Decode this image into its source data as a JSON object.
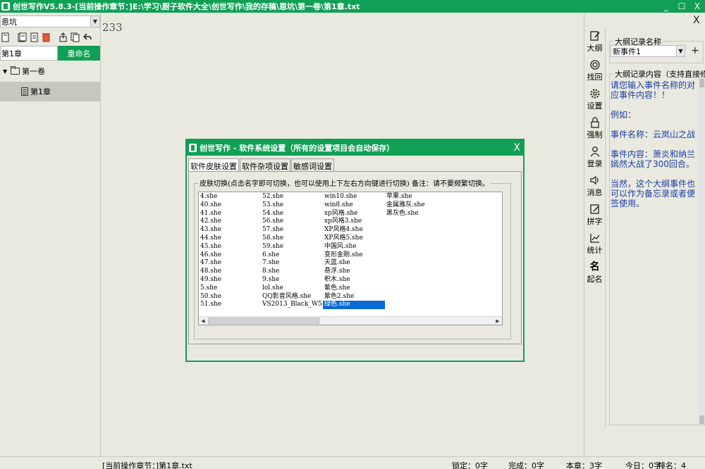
{
  "window": {
    "title": "创世写作V5.8.3-[当前操作章节：]E:\\学习\\厨子软件大全\\创世写作\\我的存稿\\恩坑\\第一卷\\第1章.txt",
    "minimize": "_",
    "maximize": "☐",
    "close": "X"
  },
  "left": {
    "book_select": "恩坑",
    "chapter_name": "第1章",
    "rename_label": "重命名",
    "tree": {
      "volume": "第一卷",
      "chapter": "第1章"
    }
  },
  "editor": {
    "content": "233"
  },
  "right_strip": [
    {
      "label": "大纲",
      "icon": "edit-icon"
    },
    {
      "label": "找回",
      "icon": "recover-icon"
    },
    {
      "label": "设置",
      "icon": "gear-icon"
    },
    {
      "label": "强制",
      "icon": "lock-icon"
    },
    {
      "label": "登录",
      "icon": "user-icon"
    },
    {
      "label": "消息",
      "icon": "speaker-icon"
    },
    {
      "label": "拼字",
      "icon": "pen-square-icon"
    },
    {
      "label": "统计",
      "icon": "chart-icon"
    },
    {
      "label": "起名",
      "icon": "name-icon",
      "glyph": "名"
    }
  ],
  "outline": {
    "close": "X",
    "name_group_label": "大纲记录名称",
    "event_name": "新事件1",
    "add": "+",
    "content_group_label": "大纲记录内容（支持直接修改）",
    "content_paragraphs": [
      "请您输入事件名称的对应事件内容！！",
      "例如：",
      "事件名称：云岚山之战",
      "事件内容：萧炎和纳兰嫣然大战了300回合。",
      "当然，这个大纲事件也可以作为备忘录或者便签使用。"
    ]
  },
  "statusbar": {
    "current_chapter": "[当前操作章节：]第1章.txt",
    "locked": "锁定：0字",
    "completed": "完成：0字",
    "this_chapter": "本章：3字",
    "today": "今日：0字",
    "rank": "排名：4"
  },
  "dialog": {
    "title": "创世写作 - 软件系统设置（所有的设置项目会自动保存）",
    "close": "X",
    "tabs": [
      "软件皮肤设置",
      "软件杂项设置",
      "敏感词设置"
    ],
    "active_tab": 0,
    "skin_group_label": "皮肤切换(点击名字即可切换，也可以使用上下左右方向键进行切换) 备注：请不要频繁切换。",
    "skin_columns": [
      [
        "4.she",
        "40.she",
        "41.she",
        "42.she",
        "43.she",
        "44.she",
        "45.she",
        "46.she",
        "47.she",
        "48.she",
        "49.she",
        "5.she",
        "50.she",
        "51.she"
      ],
      [
        "52.she",
        "53.she",
        "54.she",
        "56.she",
        "57.she",
        "58.she",
        "59.she",
        "6.she",
        "7.she",
        "8.she",
        "9.she",
        "lol.she",
        "QQ影音风格.she",
        "VS2013_Black_W5.0.she"
      ],
      [
        "win10.she",
        "win8.she",
        "xp风格.she",
        "xp风格3.she",
        "XP风格4.she",
        "XP风格5.she",
        "中国风.she",
        "变形金刚.she",
        "天蓝.she",
        "悬浮.she",
        "积木.she",
        "紫色.she",
        "紫色2.she",
        "绿色.she"
      ],
      [
        "苹果.she",
        "金属雅灰.she",
        "黑灰色.she"
      ]
    ],
    "selected_skin": "绿色.she"
  },
  "colors": {
    "accent": "#10a055",
    "selection": "#0a6ad6",
    "outline_text": "#1a3fa0"
  }
}
